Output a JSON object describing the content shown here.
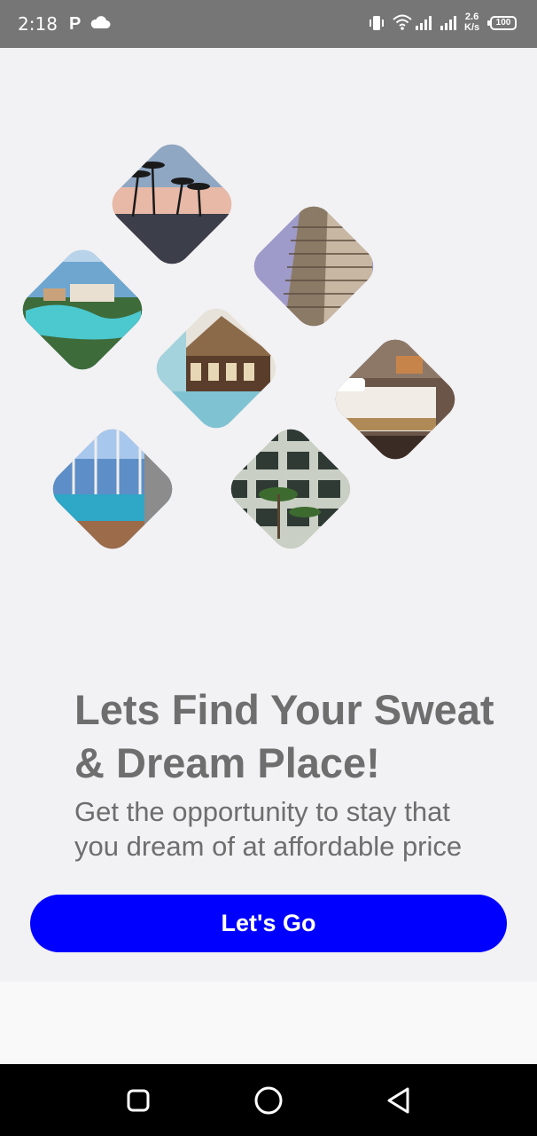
{
  "status_bar": {
    "time": "2:18",
    "app_icon": "P",
    "network_speed_value": "2.6",
    "network_speed_unit": "K/s",
    "battery": "100",
    "icons": [
      "cloud-icon",
      "vibrate-icon",
      "wifi-icon",
      "signal-icon",
      "signal-icon",
      "battery-icon"
    ]
  },
  "gallery": {
    "tiles": [
      {
        "subject": "palm-trees-sunset"
      },
      {
        "subject": "hotel-tower"
      },
      {
        "subject": "resort-pool-coast"
      },
      {
        "subject": "thatched-roof-resort"
      },
      {
        "subject": "hotel-bedroom"
      },
      {
        "subject": "glass-pool-deck"
      },
      {
        "subject": "building-facade-palms"
      }
    ]
  },
  "onboarding": {
    "title_line1": "Lets Find Your Sweat",
    "title_line2": "& Dream Place!",
    "subtitle_line1": "Get the opportunity to stay that",
    "subtitle_line2": "you dream of at affordable price",
    "cta_label": "Let's Go"
  },
  "colors": {
    "background": "#f2f1f3",
    "status_bar": "#767676",
    "text": "#6e6e6e",
    "cta": "#0000ff",
    "cta_text": "#ffffff",
    "nav_bar": "#000000"
  },
  "nav_bar": {
    "buttons": [
      "recent-apps-icon",
      "home-icon",
      "back-icon"
    ]
  }
}
